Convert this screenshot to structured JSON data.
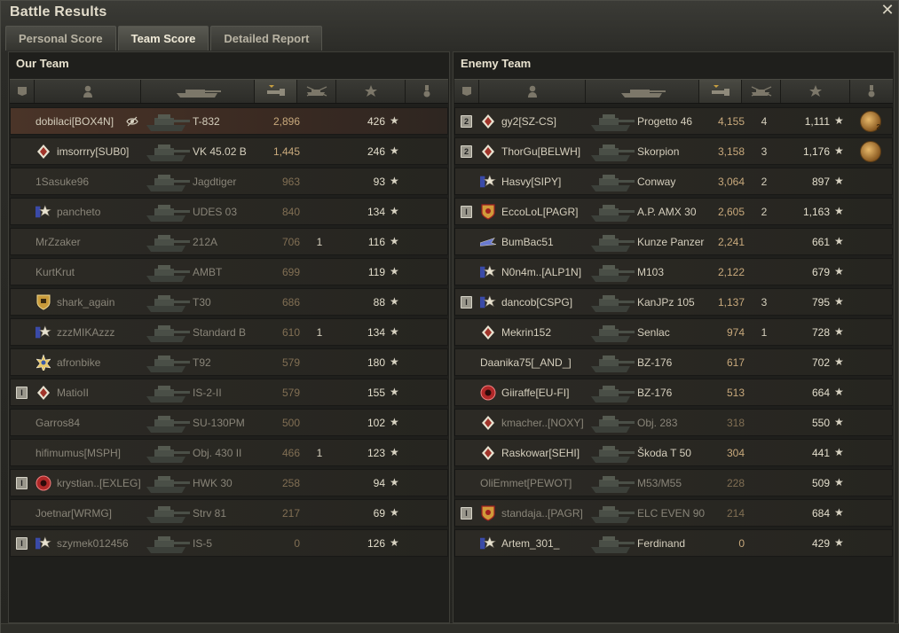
{
  "window": {
    "title": "Battle Results",
    "close_icon": "close-icon"
  },
  "tabs": [
    {
      "label": "Personal Score",
      "active": false
    },
    {
      "label": "Team Score",
      "active": true
    },
    {
      "label": "Detailed Report",
      "active": false
    }
  ],
  "our_team": {
    "title": "Our Team",
    "rows": [
      {
        "rank": "",
        "clan_icon": "",
        "name": "dobilaci[BOX4N]",
        "tank": "T-832",
        "damage": "2,896",
        "kills": "",
        "xp": "426",
        "dead": false,
        "self": true,
        "medal": ""
      },
      {
        "rank": "",
        "clan_icon": "diamond-badge-icon",
        "name": "imsorrry[SUB0]",
        "tank": "VK 45.02 B",
        "damage": "1,445",
        "kills": "",
        "xp": "246",
        "dead": false,
        "self": false,
        "medal": ""
      },
      {
        "rank": "",
        "clan_icon": "",
        "name": "1Sasuke96",
        "tank": "Jagdtiger",
        "damage": "963",
        "kills": "",
        "xp": "93",
        "dead": true,
        "self": false,
        "medal": ""
      },
      {
        "rank": "",
        "clan_icon": "star-flag-badge-icon",
        "name": "pancheto",
        "tank": "UDES 03",
        "damage": "840",
        "kills": "",
        "xp": "134",
        "dead": true,
        "self": false,
        "medal": ""
      },
      {
        "rank": "",
        "clan_icon": "",
        "name": "MrZzaker",
        "tank": "212A",
        "damage": "706",
        "kills": "1",
        "xp": "116",
        "dead": true,
        "self": false,
        "medal": ""
      },
      {
        "rank": "",
        "clan_icon": "",
        "name": "KurtKrut",
        "tank": "AMBT",
        "damage": "699",
        "kills": "",
        "xp": "119",
        "dead": true,
        "self": false,
        "medal": ""
      },
      {
        "rank": "",
        "clan_icon": "shield-badge-icon",
        "name": "shark_again",
        "tank": "T30",
        "damage": "686",
        "kills": "",
        "xp": "88",
        "dead": true,
        "self": false,
        "medal": ""
      },
      {
        "rank": "",
        "clan_icon": "star-flag-badge-icon",
        "name": "zzzMIKAzzz",
        "tank": "Standard B",
        "damage": "610",
        "kills": "1",
        "xp": "134",
        "dead": true,
        "self": false,
        "medal": ""
      },
      {
        "rank": "",
        "clan_icon": "gold-star-badge-icon",
        "name": "afronbike",
        "tank": "T92",
        "damage": "579",
        "kills": "",
        "xp": "180",
        "dead": true,
        "self": false,
        "medal": ""
      },
      {
        "rank": "I",
        "clan_icon": "diamond-badge-icon",
        "name": "MatioII",
        "tank": "IS-2-II",
        "damage": "579",
        "kills": "",
        "xp": "155",
        "dead": true,
        "self": false,
        "medal": ""
      },
      {
        "rank": "",
        "clan_icon": "",
        "name": "Garros84",
        "tank": "SU-130PM",
        "damage": "500",
        "kills": "",
        "xp": "102",
        "dead": true,
        "self": false,
        "medal": ""
      },
      {
        "rank": "",
        "clan_icon": "",
        "name": "hifimumus[MSPH]",
        "tank": "Obj. 430 II",
        "damage": "466",
        "kills": "1",
        "xp": "123",
        "dead": true,
        "self": false,
        "medal": ""
      },
      {
        "rank": "I",
        "clan_icon": "red-circle-badge-icon",
        "name": "krystian..[EXLEG]",
        "tank": "HWK 30",
        "damage": "258",
        "kills": "",
        "xp": "94",
        "dead": true,
        "self": false,
        "medal": ""
      },
      {
        "rank": "",
        "clan_icon": "",
        "name": "Joetnar[WRMG]",
        "tank": "Strv 81",
        "damage": "217",
        "kills": "",
        "xp": "69",
        "dead": true,
        "self": false,
        "medal": ""
      },
      {
        "rank": "I",
        "clan_icon": "star-flag-badge-icon",
        "name": "szymek012456",
        "tank": "IS-5",
        "damage": "0",
        "kills": "",
        "xp": "126",
        "dead": true,
        "self": false,
        "medal": ""
      }
    ]
  },
  "enemy_team": {
    "title": "Enemy Team",
    "rows": [
      {
        "rank": "2",
        "clan_icon": "diamond-badge-icon",
        "name": "gy2[SZ-CS]",
        "tank": "Progetto 46",
        "damage": "4,155",
        "kills": "4",
        "xp": "1,111",
        "dead": false,
        "self": false,
        "medal": "2"
      },
      {
        "rank": "2",
        "clan_icon": "diamond-badge-icon",
        "name": "ThorGu[BELWH]",
        "tank": "Skorpion",
        "damage": "3,158",
        "kills": "3",
        "xp": "1,176",
        "dead": false,
        "self": false,
        "medal": ""
      },
      {
        "rank": "",
        "clan_icon": "star-flag-badge-icon",
        "name": "Hasvy[SIPY]",
        "tank": "Conway",
        "damage": "3,064",
        "kills": "2",
        "xp": "897",
        "dead": false,
        "self": false,
        "medal": ""
      },
      {
        "rank": "I",
        "clan_icon": "gold-shield-badge-icon",
        "name": "EccoLoL[PAGR]",
        "tank": "A.P. AMX 30",
        "damage": "2,605",
        "kills": "2",
        "xp": "1,163",
        "dead": false,
        "self": false,
        "medal": ""
      },
      {
        "rank": "",
        "clan_icon": "plane-badge-icon",
        "name": "BumBac51",
        "tank": "Kunze Panzer",
        "damage": "2,241",
        "kills": "",
        "xp": "661",
        "dead": false,
        "self": false,
        "medal": ""
      },
      {
        "rank": "",
        "clan_icon": "star-flag-badge-icon",
        "name": "N0n4m..[ALP1N]",
        "tank": "M103",
        "damage": "2,122",
        "kills": "",
        "xp": "679",
        "dead": false,
        "self": false,
        "medal": ""
      },
      {
        "rank": "I",
        "clan_icon": "star-flag-badge-icon",
        "name": "dancob[CSPG]",
        "tank": "KanJPz 105",
        "damage": "1,137",
        "kills": "3",
        "xp": "795",
        "dead": false,
        "self": false,
        "medal": ""
      },
      {
        "rank": "",
        "clan_icon": "diamond-badge-icon",
        "name": "Mekrin152",
        "tank": "Senlac",
        "damage": "974",
        "kills": "1",
        "xp": "728",
        "dead": false,
        "self": false,
        "medal": ""
      },
      {
        "rank": "",
        "clan_icon": "",
        "name": "Daanika75[_AND_]",
        "tank": "BZ-176",
        "damage": "617",
        "kills": "",
        "xp": "702",
        "dead": false,
        "self": false,
        "medal": ""
      },
      {
        "rank": "",
        "clan_icon": "red-circle-badge-icon",
        "name": "Giiraffe[EU-FI]",
        "tank": "BZ-176",
        "damage": "513",
        "kills": "",
        "xp": "664",
        "dead": false,
        "self": false,
        "medal": ""
      },
      {
        "rank": "",
        "clan_icon": "diamond-badge-icon",
        "name": "kmacher..[NOXY]",
        "tank": "Obj. 283",
        "damage": "318",
        "kills": "",
        "xp": "550",
        "dead": true,
        "self": false,
        "medal": ""
      },
      {
        "rank": "",
        "clan_icon": "diamond-badge-icon",
        "name": "Raskowar[SEHI]",
        "tank": "Škoda T 50",
        "damage": "304",
        "kills": "",
        "xp": "441",
        "dead": false,
        "self": false,
        "medal": ""
      },
      {
        "rank": "",
        "clan_icon": "",
        "name": "OliEmmet[PEWOT]",
        "tank": "M53/M55",
        "damage": "228",
        "kills": "",
        "xp": "509",
        "dead": true,
        "self": false,
        "medal": ""
      },
      {
        "rank": "I",
        "clan_icon": "gold-shield-badge-icon",
        "name": "standaja..[PAGR]",
        "tank": "ELC EVEN 90",
        "damage": "214",
        "kills": "",
        "xp": "684",
        "dead": true,
        "self": false,
        "medal": ""
      },
      {
        "rank": "",
        "clan_icon": "star-flag-badge-icon",
        "name": "Artem_301_",
        "tank": "Ferdinand",
        "damage": "0",
        "kills": "",
        "xp": "429",
        "dead": false,
        "self": false,
        "medal": ""
      }
    ]
  },
  "medal_extra": "1",
  "colors": {
    "self_row": "#4a3428",
    "damage": "#c8a97c",
    "accent": "#e2dccb"
  }
}
